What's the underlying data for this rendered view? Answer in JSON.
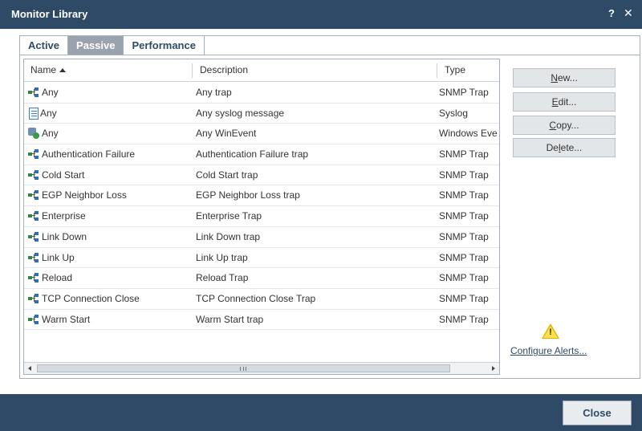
{
  "window": {
    "title": "Monitor Library",
    "help_label": "?",
    "close_label": "✕"
  },
  "tabs": [
    {
      "label": "Active",
      "selected": false
    },
    {
      "label": "Passive",
      "selected": true
    },
    {
      "label": "Performance",
      "selected": false
    }
  ],
  "table": {
    "columns": {
      "name": "Name",
      "description": "Description",
      "type": "Type"
    },
    "sort": {
      "column": "Name",
      "direction": "ascending"
    },
    "rows": [
      {
        "icon": "network-trap-icon",
        "name": "Any",
        "description": "Any trap",
        "type": "SNMP Trap"
      },
      {
        "icon": "syslog-document-icon",
        "name": "Any",
        "description": "Any syslog message",
        "type": "Syslog"
      },
      {
        "icon": "windows-event-icon",
        "name": "Any",
        "description": "Any WinEvent",
        "type": "Windows Eve"
      },
      {
        "icon": "network-trap-icon",
        "name": "Authentication Failure",
        "description": "Authentication Failure trap",
        "type": "SNMP Trap"
      },
      {
        "icon": "network-trap-icon",
        "name": "Cold Start",
        "description": "Cold Start trap",
        "type": "SNMP Trap"
      },
      {
        "icon": "network-trap-icon",
        "name": "EGP Neighbor Loss",
        "description": "EGP Neighbor Loss trap",
        "type": "SNMP Trap"
      },
      {
        "icon": "network-trap-icon",
        "name": "Enterprise",
        "description": "Enterprise Trap",
        "type": "SNMP Trap"
      },
      {
        "icon": "network-trap-icon",
        "name": "Link Down",
        "description": "Link Down trap",
        "type": "SNMP Trap"
      },
      {
        "icon": "network-trap-icon",
        "name": "Link Up",
        "description": "Link Up trap",
        "type": "SNMP Trap"
      },
      {
        "icon": "network-trap-icon",
        "name": "Reload",
        "description": "Reload Trap",
        "type": "SNMP Trap"
      },
      {
        "icon": "network-trap-icon",
        "name": "TCP Connection Close",
        "description": "TCP Connection Close Trap",
        "type": "SNMP Trap"
      },
      {
        "icon": "network-trap-icon",
        "name": "Warm Start",
        "description": "Warm Start trap",
        "type": "SNMP Trap"
      }
    ]
  },
  "actions": {
    "new": {
      "mnemonic": "N",
      "rest": "ew..."
    },
    "edit": {
      "mnemonic": "E",
      "rest": "dit..."
    },
    "copy": {
      "mnemonic": "C",
      "rest": "opy..."
    },
    "delete": {
      "pre": "De",
      "mnemonic": "l",
      "rest": "ete..."
    }
  },
  "alerts": {
    "icon": "warning-icon",
    "configure_label": "Configure Alerts..."
  },
  "footer": {
    "close_label": "Close"
  },
  "colors": {
    "accent": "#2e4a66",
    "tab_selected_bg": "#9aa3ad",
    "button_bg": "#e3e6e9",
    "warning": "#ffe24a"
  }
}
